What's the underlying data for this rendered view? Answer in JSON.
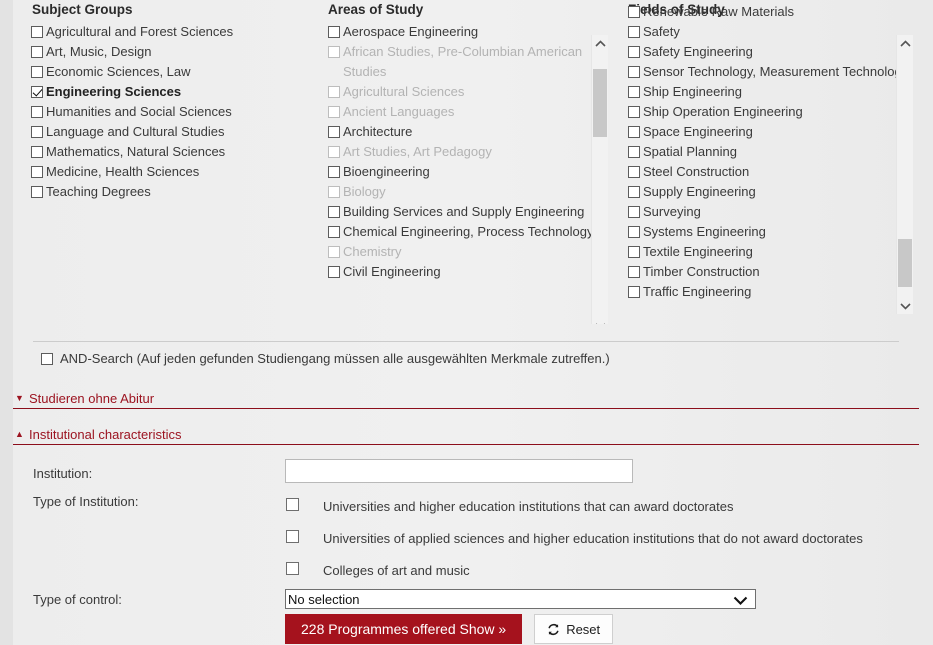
{
  "columns": [
    {
      "title": "Subject Groups",
      "has_scrollbar": false,
      "options": [
        {
          "label": "Agricultural and Forest Sciences",
          "checked": false,
          "disabled": false
        },
        {
          "label": "Art, Music, Design",
          "checked": false,
          "disabled": false
        },
        {
          "label": "Economic Sciences, Law",
          "checked": false,
          "disabled": false
        },
        {
          "label": "Engineering Sciences",
          "checked": true,
          "disabled": false
        },
        {
          "label": "Humanities and Social Sciences",
          "checked": false,
          "disabled": false
        },
        {
          "label": "Language and Cultural Studies",
          "checked": false,
          "disabled": false
        },
        {
          "label": "Mathematics, Natural Sciences",
          "checked": false,
          "disabled": false
        },
        {
          "label": "Medicine, Health Sciences",
          "checked": false,
          "disabled": false
        },
        {
          "label": "Teaching Degrees",
          "checked": false,
          "disabled": false
        }
      ]
    },
    {
      "title": "Areas of Study",
      "has_scrollbar": true,
      "scroll_thumb_top_pct": 6,
      "scroll_thumb_height_pct": 22,
      "options": [
        {
          "label": "Aerospace Engineering",
          "checked": false,
          "disabled": false
        },
        {
          "label": "African Studies, Pre-Columbian American Studies",
          "checked": false,
          "disabled": true
        },
        {
          "label": "Agricultural Sciences",
          "checked": false,
          "disabled": true
        },
        {
          "label": "Ancient Languages",
          "checked": false,
          "disabled": true
        },
        {
          "label": "Architecture",
          "checked": false,
          "disabled": false
        },
        {
          "label": "Art Studies, Art Pedagogy",
          "checked": false,
          "disabled": true
        },
        {
          "label": "Bioengineering",
          "checked": false,
          "disabled": false
        },
        {
          "label": "Biology",
          "checked": false,
          "disabled": true
        },
        {
          "label": "Building Services and Supply Engineering",
          "checked": false,
          "disabled": false
        },
        {
          "label": "Chemical Engineering, Process Technology",
          "checked": false,
          "disabled": false
        },
        {
          "label": "Chemistry",
          "checked": false,
          "disabled": true
        },
        {
          "label": "Civil Engineering",
          "checked": false,
          "disabled": false
        }
      ]
    },
    {
      "title": "Fields of Study",
      "has_scrollbar": true,
      "scroll_thumb_top_pct": 76,
      "scroll_thumb_height_pct": 17,
      "options": [
        {
          "label": "Renewable Raw Materials",
          "checked": false,
          "disabled": false
        },
        {
          "label": "Safety",
          "checked": false,
          "disabled": false
        },
        {
          "label": "Safety Engineering",
          "checked": false,
          "disabled": false
        },
        {
          "label": "Sensor Technology, Measurement Technology",
          "checked": false,
          "disabled": false
        },
        {
          "label": "Ship Engineering",
          "checked": false,
          "disabled": false
        },
        {
          "label": "Ship Operation Engineering",
          "checked": false,
          "disabled": false
        },
        {
          "label": "Space Engineering",
          "checked": false,
          "disabled": false
        },
        {
          "label": "Spatial Planning",
          "checked": false,
          "disabled": false
        },
        {
          "label": "Steel Construction",
          "checked": false,
          "disabled": false
        },
        {
          "label": "Supply Engineering",
          "checked": false,
          "disabled": false
        },
        {
          "label": "Surveying",
          "checked": false,
          "disabled": false
        },
        {
          "label": "Systems Engineering",
          "checked": false,
          "disabled": false
        },
        {
          "label": "Textile Engineering",
          "checked": false,
          "disabled": false
        },
        {
          "label": "Timber Construction",
          "checked": false,
          "disabled": false
        },
        {
          "label": "Traffic Engineering",
          "checked": false,
          "disabled": false
        }
      ]
    }
  ],
  "and_search": {
    "label": "AND-Search (Auf jeden gefunden Studiengang müssen alle ausgewählten Merkmale zutreffen.)",
    "checked": false
  },
  "accordions": [
    {
      "label": "Studieren ohne Abitur",
      "expanded": false,
      "marker": "▼"
    },
    {
      "label": "Institutional characteristics",
      "expanded": true,
      "marker": "▲"
    }
  ],
  "institution_form": {
    "institution_label": "Institution:",
    "institution_value": "",
    "institution_placeholder": "",
    "type_of_institution_label": "Type of Institution:",
    "type_of_institution_options": [
      {
        "label": "Universities and higher education institutions that can award doctorates",
        "checked": false
      },
      {
        "label": "Universities of applied sciences and higher education institutions that do not award doctorates",
        "checked": false
      },
      {
        "label": "Colleges of art and music",
        "checked": false
      }
    ],
    "type_of_control_label": "Type of control:",
    "type_of_control_value": "No selection",
    "type_of_control_options": [
      "No selection"
    ]
  },
  "actions": {
    "submit_label": "228 Programmes offered Show »",
    "submit_count": 228,
    "reset_label": "Reset"
  },
  "theme": {
    "accent_red": "#a5121d",
    "rule_red": "#8c0e1b",
    "page_bg": "#ededed",
    "disabled_text": "#b3b3b3"
  }
}
